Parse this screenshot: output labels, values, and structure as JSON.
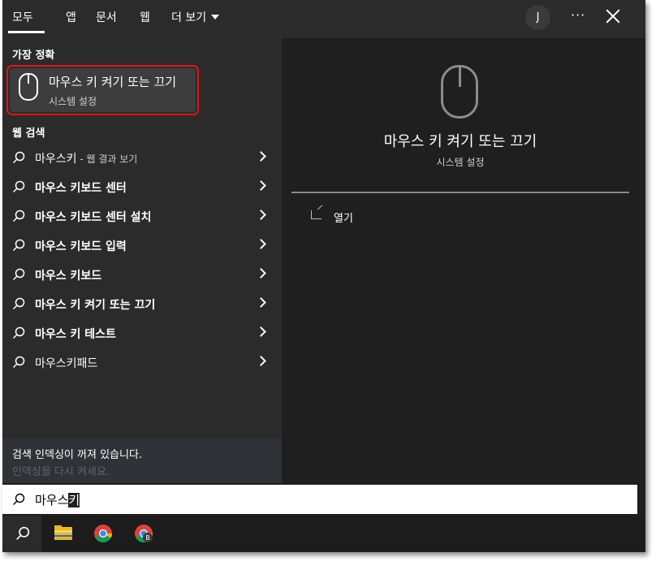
{
  "tabs": [
    {
      "label": "모두",
      "active": true
    },
    {
      "label": "앱"
    },
    {
      "label": "문서"
    },
    {
      "label": "웹"
    },
    {
      "label": "더 보기"
    }
  ],
  "header": {
    "avatar_letter": "J",
    "more_label": "···"
  },
  "best_match": {
    "heading": "가장 정확",
    "title": "마우스 키 켜기 또는 끄기",
    "subtitle": "시스템 설정",
    "icon": "mouse-icon"
  },
  "web": {
    "heading": "웹 검색",
    "items": [
      {
        "label": "마우스키",
        "suffix": " - 웹 결과 보기",
        "bold": false
      },
      {
        "label": "마우스 키보드 센터",
        "bold": true
      },
      {
        "label": "마우스 키보드 센터 설치",
        "bold": true
      },
      {
        "label": "마우스 키보드 입력",
        "bold": true
      },
      {
        "label": "마우스 키보드",
        "bold": true
      },
      {
        "label": "마우스 키 켜기 또는 끄기",
        "bold": true
      },
      {
        "label": "마우스 키 테스트",
        "bold": true
      },
      {
        "label": "마우스키패드",
        "bold": false
      }
    ]
  },
  "notice": {
    "text": "검색 인덱싱이 꺼져 있습니다.",
    "link": "인덱싱을 다시 켜세요."
  },
  "preview": {
    "title": "마우스 키 켜기 또는 끄기",
    "subtitle": "시스템 설정",
    "action_open": "열기"
  },
  "search": {
    "value_prefix": "마우스",
    "value_composing": "키"
  },
  "taskbar": {
    "icons": [
      "search-icon",
      "file-explorer-icon",
      "chrome-icon",
      "chrome-profile-icon"
    ],
    "profile_badge": "B"
  },
  "colors": {
    "highlight_border": "#e8101a",
    "panel_bg": "#2b2b2b",
    "preview_bg": "#1f1f1f"
  }
}
